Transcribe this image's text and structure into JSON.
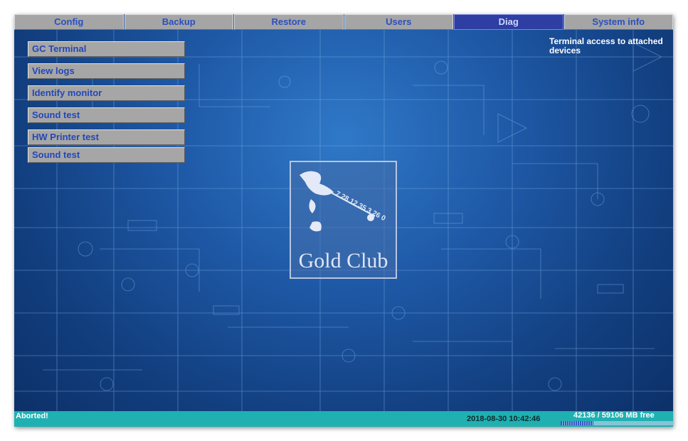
{
  "tabs": [
    {
      "label": "Config",
      "active": false
    },
    {
      "label": "Backup",
      "active": false
    },
    {
      "label": "Restore",
      "active": false
    },
    {
      "label": "Users",
      "active": false
    },
    {
      "label": "Diag",
      "active": true
    },
    {
      "label": "System info",
      "active": false
    }
  ],
  "menu": [
    {
      "label": "GC Terminal"
    },
    {
      "label": "View logs"
    },
    {
      "label": "Identify monitor"
    },
    {
      "label": "Sound test"
    },
    {
      "label": "HW Printer test"
    },
    {
      "label": "Sound test"
    }
  ],
  "hint": "Terminal access to attached devices",
  "logo": {
    "text": "Gold Club",
    "dial_text": "7 28 12 35 3 26 0"
  },
  "status": {
    "message": "Aborted!",
    "datetime": "2018-08-30 10:42:46",
    "disk_free": "42136 / 59106 MB free",
    "disk_used_fraction": 0.29
  },
  "colors": {
    "accent": "#2e3ea3",
    "status_bar": "#1fb0b2",
    "tab": "#a5a5a5"
  }
}
